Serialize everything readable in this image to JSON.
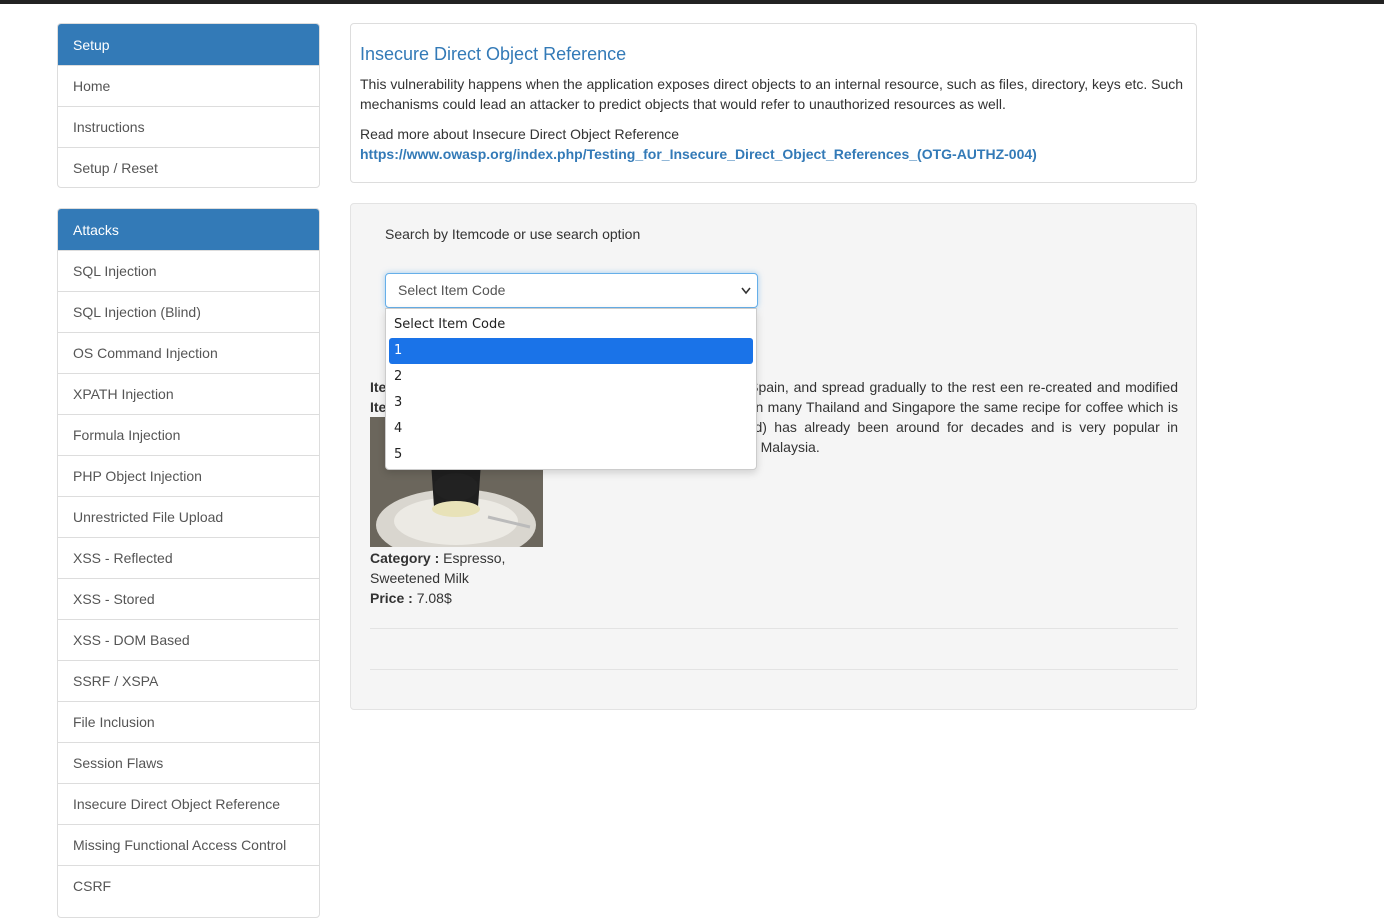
{
  "sidebar": {
    "setup": {
      "header": "Setup",
      "items": [
        "Home",
        "Instructions",
        "Setup / Reset"
      ]
    },
    "attacks": {
      "header": "Attacks",
      "items": [
        "SQL Injection",
        "SQL Injection (Blind)",
        "OS Command Injection",
        "XPATH Injection",
        "Formula Injection",
        "PHP Object Injection",
        "Unrestricted File Upload",
        "XSS - Reflected",
        "XSS - Stored",
        "XSS - DOM Based",
        "SSRF / XSPA",
        "File Inclusion",
        "Session Flaws",
        "Insecure Direct Object Reference",
        "Missing Functional Access Control",
        "CSRF"
      ]
    }
  },
  "info": {
    "title": "Insecure Direct Object Reference",
    "description": "This vulnerability happens when the application exposes direct objects to an internal resource, such as files, directory, keys etc. Such mechanisms could lead an attacker to predict objects that would refer to unauthorized resources as well.",
    "read_more": "Read more about Insecure Direct Object Reference",
    "link": "https://www.owasp.org/index.php/Testing_for_Insecure_Direct_Object_References_(OTG-AUTHZ-004)"
  },
  "search": {
    "label": "Search by Itemcode or use search option",
    "select_value": "Select Item Code",
    "options": [
      "Select Item Code",
      "1",
      "2",
      "3",
      "4",
      "5"
    ],
    "highlighted_option": "1"
  },
  "item": {
    "label_prefix_1": "Ite",
    "label_prefix_2": "Ite",
    "description": "as made popular in Valencia, Spain, and spread gradually to the rest een re-created and modified to suit European tastebuds as in many Thailand and Singapore the same recipe for coffee which is called or \"Kafe Ron\" (Thailand) has already been around for decades and is very popular in \"mamak\" stalls or \"kopitiams\" in Malaysia.",
    "category_label": "Category :",
    "category_value": "Espresso, Sweetened Milk",
    "price_label": "Price :",
    "price_value": "7.08$"
  },
  "colors": {
    "primary": "#337ab7",
    "dropdown_highlight": "#1a73e8",
    "topbar": "#222222"
  }
}
